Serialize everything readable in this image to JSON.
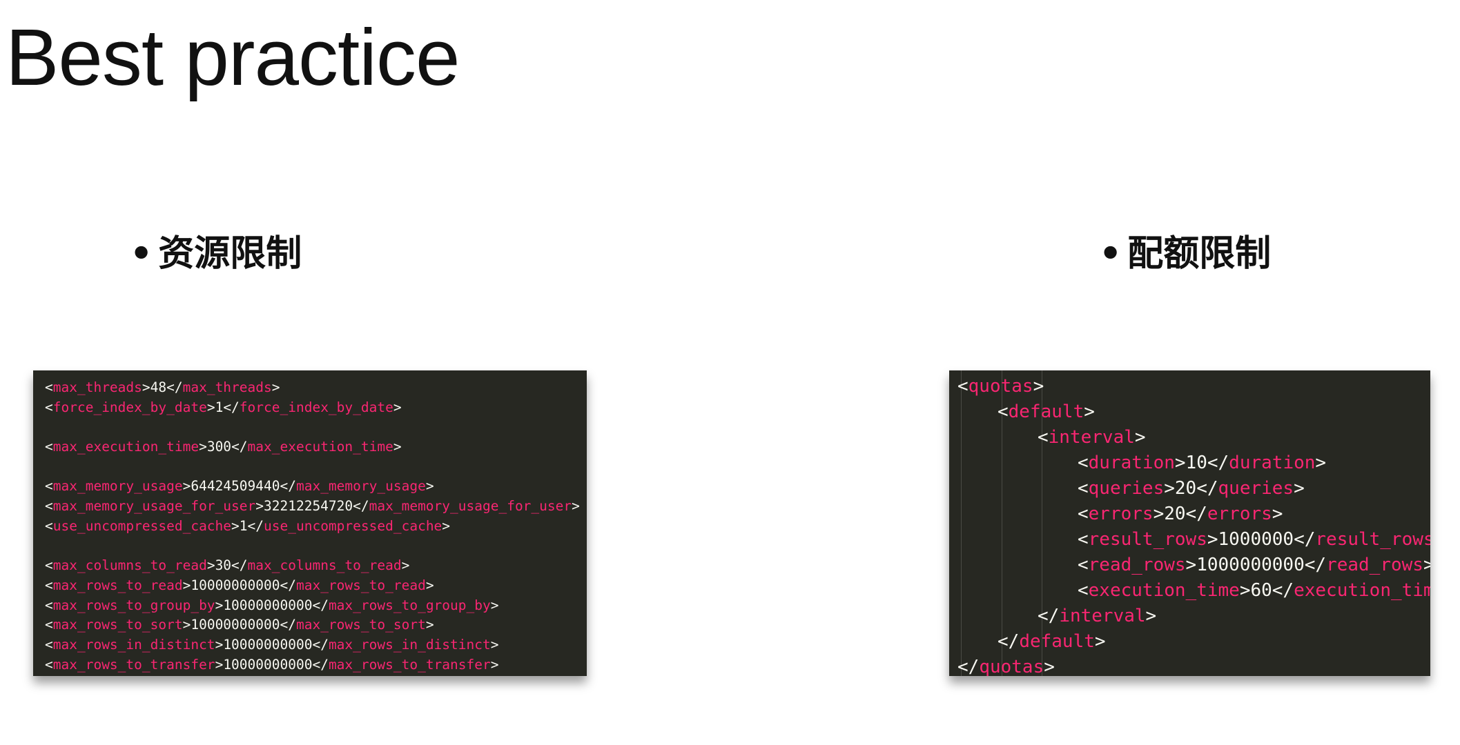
{
  "title": "Best practice",
  "sections": [
    {
      "bullet": "•",
      "heading": "资源限制"
    },
    {
      "bullet": "•",
      "heading": "配额限制"
    }
  ],
  "left_code": {
    "lines": [
      {
        "tag": "max_threads",
        "value": "48"
      },
      {
        "tag": "force_index_by_date",
        "value": "1"
      },
      {
        "blank": true
      },
      {
        "tag": "max_execution_time",
        "value": "300"
      },
      {
        "blank": true
      },
      {
        "tag": "max_memory_usage",
        "value": "64424509440"
      },
      {
        "tag": "max_memory_usage_for_user",
        "value": "32212254720"
      },
      {
        "tag": "use_uncompressed_cache",
        "value": "1"
      },
      {
        "blank": true
      },
      {
        "tag": "max_columns_to_read",
        "value": "30"
      },
      {
        "tag": "max_rows_to_read",
        "value": "10000000000"
      },
      {
        "tag": "max_rows_to_group_by",
        "value": "10000000000"
      },
      {
        "tag": "max_rows_to_sort",
        "value": "10000000000"
      },
      {
        "tag": "max_rows_in_distinct",
        "value": "10000000000"
      },
      {
        "tag": "max_rows_to_transfer",
        "value": "10000000000"
      }
    ]
  },
  "right_code": {
    "lines": [
      {
        "indent": 0,
        "open": "quotas"
      },
      {
        "indent": 1,
        "open": "default"
      },
      {
        "indent": 2,
        "open": "interval"
      },
      {
        "indent": 3,
        "tag": "duration",
        "value": "10"
      },
      {
        "indent": 3,
        "tag": "queries",
        "value": "20"
      },
      {
        "indent": 3,
        "tag": "errors",
        "value": "20"
      },
      {
        "indent": 3,
        "tag": "result_rows",
        "value": "1000000"
      },
      {
        "indent": 3,
        "tag": "read_rows",
        "value": "1000000000"
      },
      {
        "indent": 3,
        "tag": "execution_time",
        "value": "60"
      },
      {
        "indent": 2,
        "close": "interval"
      },
      {
        "indent": 1,
        "close": "default"
      },
      {
        "indent": 0,
        "close": "quotas"
      }
    ]
  }
}
